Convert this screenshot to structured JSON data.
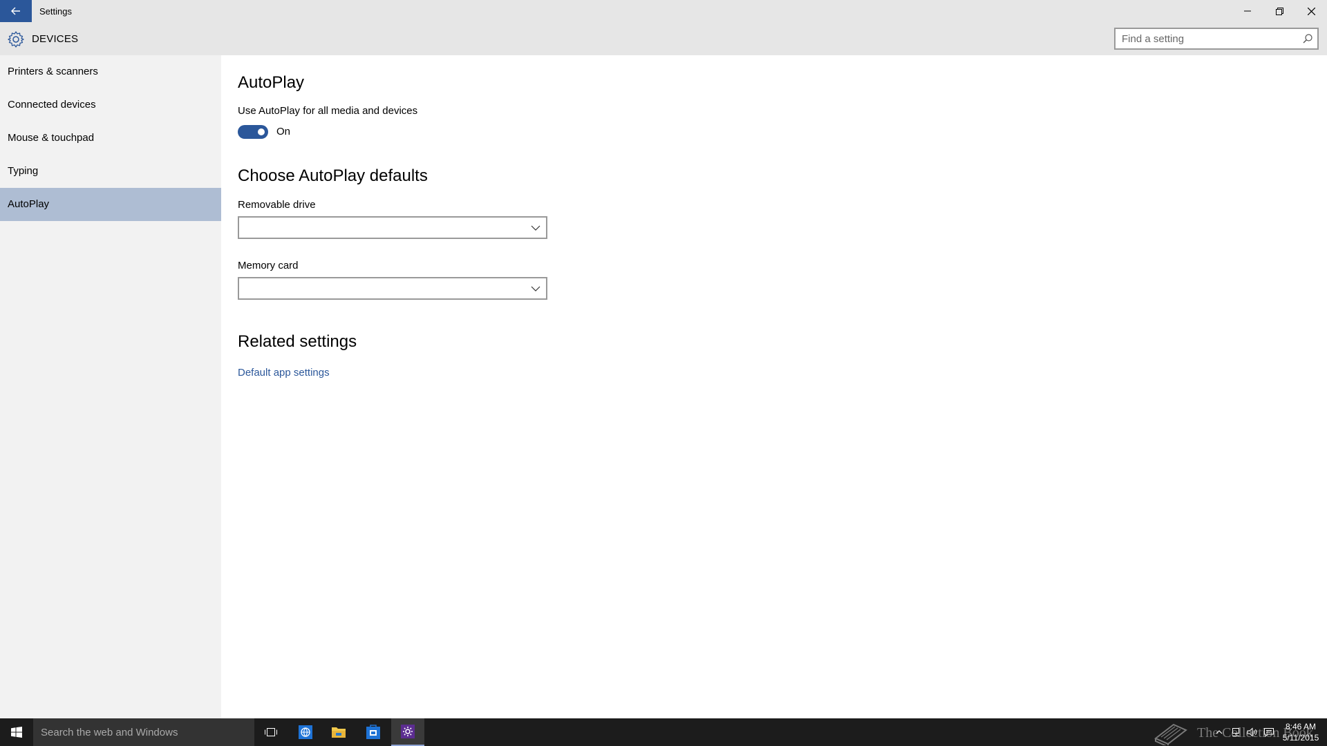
{
  "window": {
    "title": "Settings",
    "controls": [
      "minimize",
      "restore",
      "close"
    ]
  },
  "header": {
    "title": "DEVICES",
    "icon": "gear-icon"
  },
  "search": {
    "placeholder": "Find a setting",
    "value": ""
  },
  "sidebar": {
    "items": [
      {
        "label": "Printers & scanners",
        "selected": false
      },
      {
        "label": "Connected devices",
        "selected": false
      },
      {
        "label": "Mouse & touchpad",
        "selected": false
      },
      {
        "label": "Typing",
        "selected": false
      },
      {
        "label": "AutoPlay",
        "selected": true
      }
    ]
  },
  "autoplay": {
    "heading": "AutoPlay",
    "toggle_label": "Use AutoPlay for all media and devices",
    "toggle_state_text": "On",
    "toggle_on": true
  },
  "defaults": {
    "heading": "Choose AutoPlay defaults",
    "removable_label": "Removable drive",
    "removable_value": "",
    "memory_label": "Memory card",
    "memory_value": ""
  },
  "related": {
    "heading": "Related settings",
    "link": "Default app settings"
  },
  "taskbar": {
    "search_placeholder": "Search the web and Windows",
    "watermark": "The Collection Book",
    "time": "8:46 AM",
    "date": "5/11/2015"
  },
  "colors": {
    "accent": "#2b579a",
    "selected_nav": "#aebdd3",
    "chrome": "#e6e6e6",
    "sidebar": "#f2f2f2",
    "taskbar": "#1c1c1c"
  }
}
